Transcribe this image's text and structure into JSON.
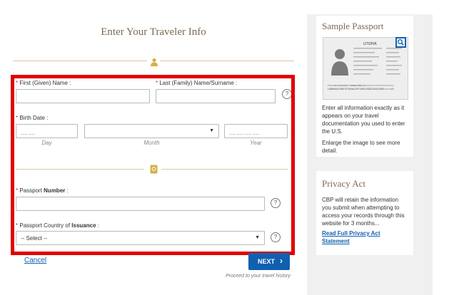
{
  "form": {
    "title": "Enter Your Traveler Info",
    "first_name_label": "First (Given) Name :",
    "last_name_label": "Last (Family) Name/Surname :",
    "birth_date_label": "Birth Date :",
    "day_placeholder": "__ __",
    "month_selected": "",
    "year_placeholder": "__ __ __ __",
    "day_caption": "Day",
    "month_caption": "Month",
    "year_caption": "Year",
    "passport_number_label_prefix": "Passport ",
    "passport_number_label_bold": "Number",
    "passport_number_label_suffix": " :",
    "passport_country_label_prefix": "Passport Country of ",
    "passport_country_label_bold": "Issuance",
    "passport_country_label_suffix": " :",
    "country_selected": "-- Select --",
    "required_mark": "*",
    "help_glyph": "?"
  },
  "actions": {
    "cancel_label": "Cancel",
    "next_label": "NEXT",
    "next_caption": "Proceed to your travel history"
  },
  "sidebar": {
    "passport_title": "Sample Passport",
    "passport_text": "Enter all information exactly as it appears on your travel documentation you used to enter the U.S.",
    "enlarge_text": "Enlarge the image to see more detail.",
    "passport_image": {
      "country": "UTOPIA",
      "mrz_line1": "P<UTOERIKSSON<<ANNA<MARIA<<<<<<<<<<<<<<<<<<<",
      "mrz_line2": "L898902C36UTO7408122F1204159ZE184226B<<<<<10"
    },
    "privacy_title": "Privacy Act",
    "privacy_text": "CBP will retain the information you submit when attempting to access your records through this website for 3 months...",
    "privacy_link": "Read Full Privacy Act Statement"
  },
  "colors": {
    "highlight_border": "#e10000",
    "accent_gold": "#d4b04a",
    "primary_button": "#1060b0",
    "link": "#1060b0"
  },
  "icons": {
    "traveler": "person-icon",
    "passport": "passport-icon",
    "zoom": "magnifier-icon",
    "help": "question-circle-icon",
    "next": "chevron-right-icon"
  }
}
